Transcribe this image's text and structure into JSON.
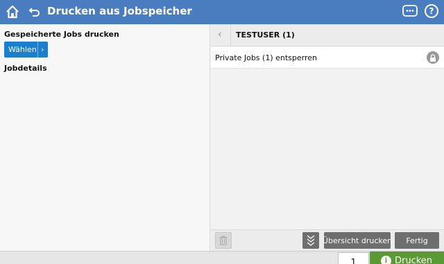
{
  "header": {
    "title": "Drucken aus Jobspeicher",
    "help_label": "?"
  },
  "left": {
    "saved_jobs_label": "Gespeicherte Jobs drucken",
    "select_button": "Wählen",
    "job_details_label": "Jobdetails"
  },
  "right": {
    "user_name": "TESTUSER (1)",
    "private_jobs_label": "Private Jobs (1) entsperren"
  },
  "toolbar": {
    "overview_button": "Übersicht drucken",
    "done_button": "Fertig"
  },
  "footer": {
    "copies_value": "1",
    "print_button": "Drucken",
    "accent_color": "#5a9a32"
  },
  "colors": {
    "header": "#4a7dc0",
    "select_button": "#1a7fd0"
  }
}
